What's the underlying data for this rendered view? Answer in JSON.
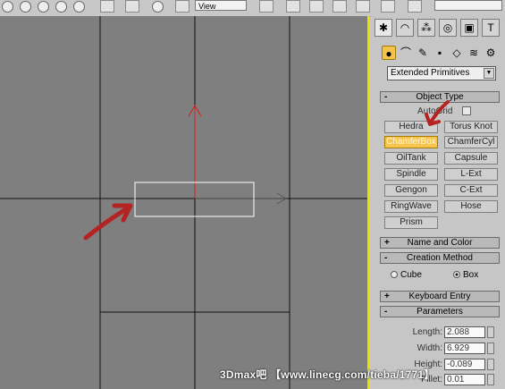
{
  "toolbar": {
    "reference_dropdown": "View",
    "buttons": [
      "select-icon",
      "rotate-icon",
      "scale-icon",
      "link-icon",
      "unlink-icon",
      "bind-space-warp-icon",
      "mirror-icon",
      "align-icon",
      "layer-icon",
      "curve-editor-icon",
      "material-editor-icon"
    ]
  },
  "command_panel": {
    "tabs": [
      "create-tab",
      "modify-tab",
      "hierarchy-tab",
      "motion-tab",
      "display-tab",
      "utilities-tab"
    ],
    "subcategories": [
      "geometry-icon",
      "shapes-icon",
      "lights-icon",
      "cameras-icon",
      "helpers-icon",
      "space-warps-icon",
      "systems-icon"
    ],
    "category": "Extended Primitives",
    "object_type": {
      "header": "Object Type",
      "autogrid_label": "AutoGrid",
      "buttons": [
        "Hedra",
        "Torus Knot",
        "ChamferBox",
        "ChamferCyl",
        "OilTank",
        "Capsule",
        "Spindle",
        "L-Ext",
        "Gengon",
        "C-Ext",
        "RingWave",
        "Hose",
        "Prism"
      ],
      "active": "ChamferBox"
    },
    "name_and_color": "Name and Color",
    "creation_method": {
      "header": "Creation Method",
      "options": [
        "Cube",
        "Box"
      ],
      "selected": "Box"
    },
    "keyboard_entry": "Keyboard Entry",
    "parameters": {
      "header": "Parameters",
      "fields": [
        {
          "label": "Length:",
          "value": "2.088"
        },
        {
          "label": "Width:",
          "value": "6.929"
        },
        {
          "label": "Height:",
          "value": "-0.089"
        },
        {
          "label": "Fillet:",
          "value": "0.01"
        }
      ]
    },
    "signs": {
      "expanded": "-",
      "collapsed": "+"
    }
  },
  "watermark": "3Dmax吧 【www.linecg.com/tieba/1771】",
  "colors": {
    "viewport_bg": "#7f7f7f",
    "active_border": "#f0e000",
    "axis_y": "#d42020",
    "annotation_arrow": "#b52222",
    "active_button": "#f7c44c"
  }
}
